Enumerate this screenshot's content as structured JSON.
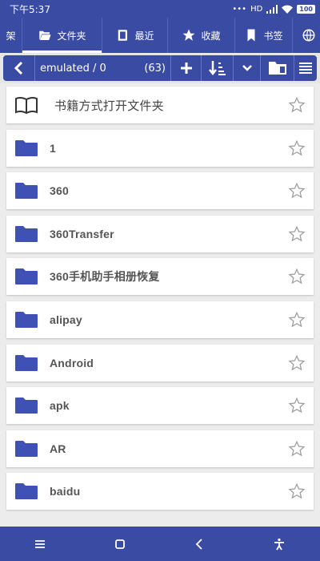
{
  "status": {
    "time": "下午5:37",
    "signal_text": "HD",
    "battery": "100"
  },
  "tabs": [
    {
      "label": "架",
      "icon": "partial-tab-icon"
    },
    {
      "label": "文件夹",
      "icon": "folder-open-icon"
    },
    {
      "label": "最近",
      "icon": "recent-icon"
    },
    {
      "label": "收藏",
      "icon": "star-icon"
    },
    {
      "label": "书签",
      "icon": "bookmark-icon"
    },
    {
      "label": "",
      "icon": "globe-icon"
    }
  ],
  "toolbar": {
    "path": "emulated / 0",
    "count": "(63)"
  },
  "book_row": {
    "label": "书籍方式打开文件夹"
  },
  "folders": [
    {
      "name": "1"
    },
    {
      "name": "360"
    },
    {
      "name": "360Transfer"
    },
    {
      "name": "360手机助手相册恢复"
    },
    {
      "name": "alipay"
    },
    {
      "name": "Android"
    },
    {
      "name": "apk"
    },
    {
      "name": "AR"
    },
    {
      "name": "baidu"
    }
  ],
  "colors": {
    "primary": "#3a4ba3",
    "folder": "#3f51b5",
    "star_outline": "#9e9e9e"
  }
}
